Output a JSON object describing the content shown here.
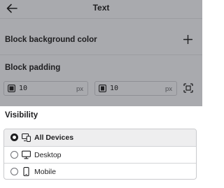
{
  "colors": {
    "overlay": "#a9aaae",
    "text": "#1e1e20",
    "selected_row": "#eeeeef"
  },
  "header": {
    "title": "Text",
    "back_icon": "arrow-left-icon"
  },
  "block_background": {
    "label": "Block background color",
    "add_icon": "plus-icon"
  },
  "block_padding": {
    "label": "Block padding",
    "vertical": {
      "value": "10",
      "unit": "px",
      "icon": "padding-vertical-icon"
    },
    "horizontal": {
      "value": "10",
      "unit": "px",
      "icon": "padding-horizontal-icon"
    },
    "individual_icon": "padding-individual-icon"
  },
  "visibility": {
    "title": "Visibility",
    "selected": "All Devices",
    "options": [
      {
        "label": "All Devices",
        "icon": "all-devices-icon"
      },
      {
        "label": "Desktop",
        "icon": "desktop-icon"
      },
      {
        "label": "Mobile",
        "icon": "mobile-icon"
      }
    ]
  }
}
